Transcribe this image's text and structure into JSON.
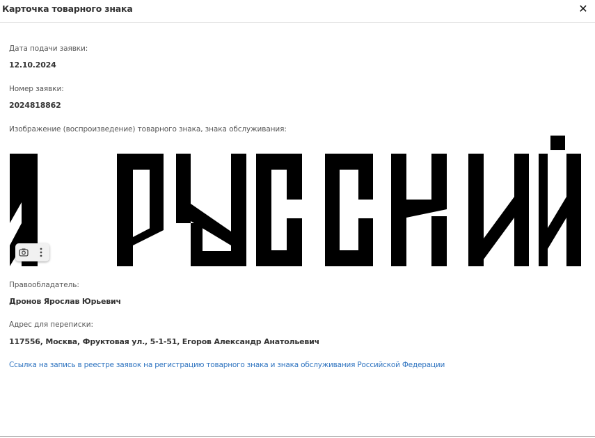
{
  "modal": {
    "title": "Карточка товарного знака",
    "close_symbol": "✕"
  },
  "fields": {
    "filing_date_label": "Дата подачи заявки:",
    "filing_date": "12.10.2024",
    "application_number_label": "Номер заявки:",
    "application_number": "2024818862",
    "image_label": "Изображение (воспроизведение) товарного знака, знака обслуживания:",
    "owner_label": "Правообладатель:",
    "owner": "Дронов Ярослав Юрьевич",
    "address_label": "Адрес для переписки:",
    "address": "117556, Москва, Фруктовая ул., 5-1-51, Егоров Александр Анатольевич"
  },
  "registry_link": "Ссылка на запись в реестре заявок на регистрацию товарного знака и знака обслуживания Российской Федерации",
  "trademark_image": {
    "text": "Я РУССКИЙ",
    "color": "#000000"
  },
  "image_tools": {
    "camera_icon": "camera-search-icon",
    "more_icon": "kebab-menu-icon"
  },
  "colors": {
    "link": "#2f74c0",
    "text": "#333333",
    "label": "#555555"
  }
}
